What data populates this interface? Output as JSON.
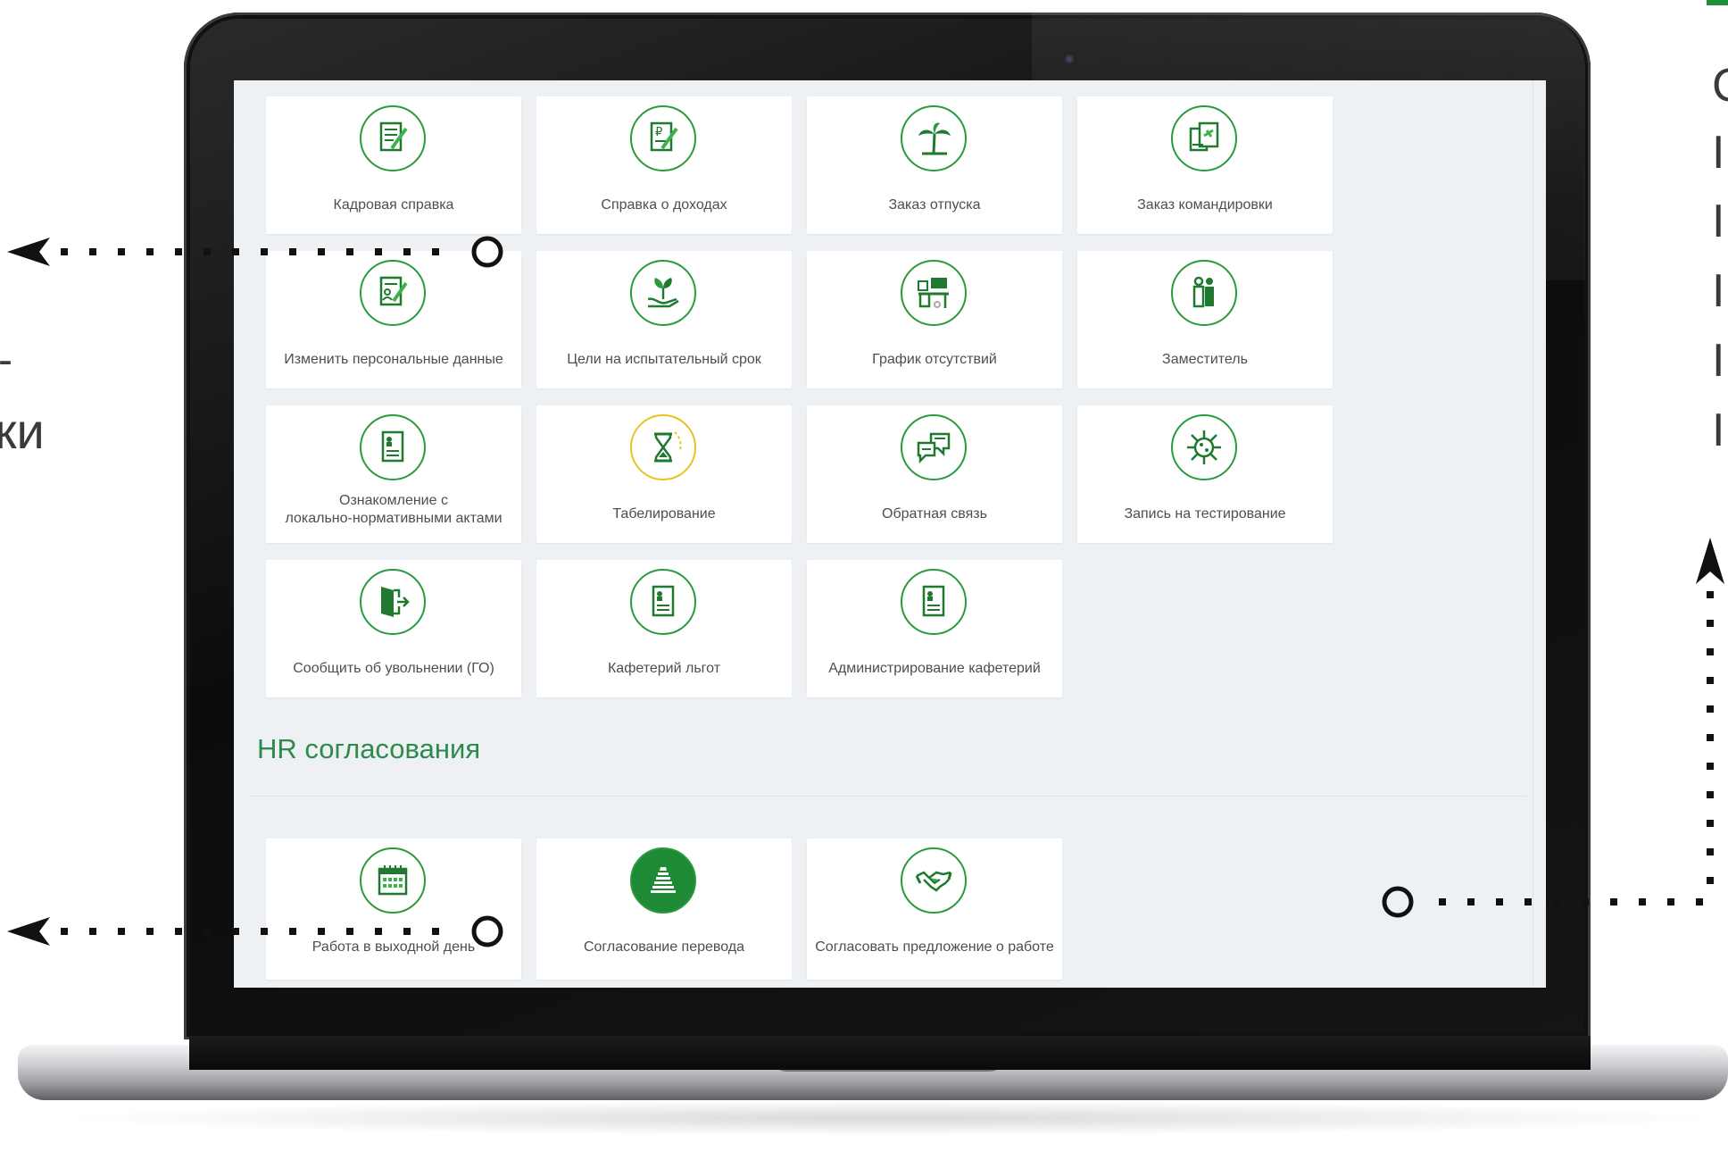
{
  "left_fragments": {
    "dash": "-",
    "ki": "ки"
  },
  "right_fragments": [
    "C",
    "I",
    "I",
    "I",
    "I",
    "I"
  ],
  "accent_color": "#2a9a3e",
  "service_cards": [
    {
      "label": "Кадровая справка",
      "icon": "document-pen-icon"
    },
    {
      "label": "Справка о доходах",
      "icon": "ruble-document-icon"
    },
    {
      "label": "Заказ отпуска",
      "icon": "palm-tree-icon"
    },
    {
      "label": "Заказ командировки",
      "icon": "travel-documents-icon"
    },
    {
      "label": "Изменить персональные данные",
      "icon": "profile-edit-icon"
    },
    {
      "label": "Цели на испытательный срок",
      "icon": "plant-hand-icon"
    },
    {
      "label": "График отсутствий",
      "icon": "desk-schedule-icon"
    },
    {
      "label": "Заместитель",
      "icon": "two-people-icon"
    },
    {
      "label_line1": "Ознакомление с",
      "label_line2": "локально-нормативными актами",
      "icon": "badge-document-icon"
    },
    {
      "label": "Табелирование",
      "icon": "hourglass-icon"
    },
    {
      "label": "Обратная связь",
      "icon": "chat-bubbles-icon"
    },
    {
      "label": "Запись на тестирование",
      "icon": "virus-icon"
    },
    {
      "label": "Сообщить об увольнении (ГО)",
      "icon": "exit-door-icon"
    },
    {
      "label": "Кафетерий льгот",
      "icon": "badge-document-icon"
    },
    {
      "label": "Администрирование кафетерий",
      "icon": "badge-document-icon"
    }
  ],
  "hr_section": {
    "title": "HR согласования",
    "cards": [
      {
        "label": "Работа в выходной день",
        "icon": "calendar-icon"
      },
      {
        "label": "Согласование перевода",
        "icon": "stairs-icon"
      },
      {
        "label": "Согласовать предложение о работе",
        "icon": "handshake-icon"
      }
    ]
  }
}
